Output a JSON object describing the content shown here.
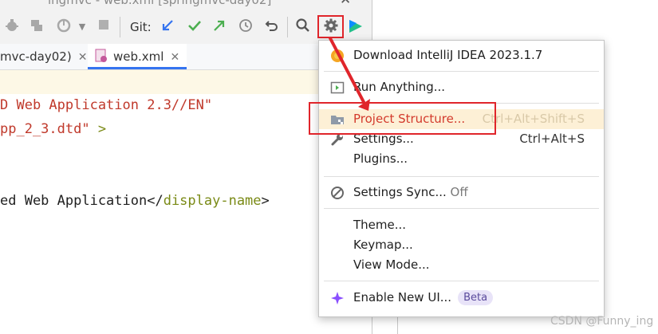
{
  "window": {
    "title": "ingmvc - web.xml [springmvc-day02]",
    "close_glyph": "✕"
  },
  "toolbar": {
    "git_label": "Git:",
    "icons": [
      "debug-icon",
      "coverage-icon",
      "profile-icon",
      "dropdown-icon",
      "stop-icon",
      "git-update-icon",
      "git-commit-icon",
      "git-push-icon",
      "history-icon",
      "rollback-icon",
      "search-icon",
      "gear-icon",
      "jetbrains-logo-icon"
    ]
  },
  "tabs": [
    {
      "label": "mvc-day02)",
      "close": "✕"
    },
    {
      "label": "web.xml",
      "close": "✕"
    }
  ],
  "editor": {
    "lines": [
      {
        "text": "D Web Application 2.3//EN\""
      },
      {
        "text": "pp_2_3.dtd\"",
        "suffix": " >"
      },
      {
        "text": ""
      },
      {
        "text": "ed Web Application</",
        "tag": "display-name",
        "suffix": ">"
      }
    ]
  },
  "menu": {
    "items": [
      {
        "label": "Download IntelliJ IDEA 2023.1.7",
        "icon": "update-icon"
      },
      {
        "label": "Run Anything...",
        "icon": "run-anything-icon"
      },
      {
        "label": "Project Structure...",
        "shortcut": "Ctrl+Alt+Shift+S",
        "icon": "project-structure-icon",
        "highlighted": true
      },
      {
        "label": "Settings...",
        "shortcut": "Ctrl+Alt+S",
        "icon": "wrench-icon"
      },
      {
        "label": "Plugins..."
      },
      {
        "label": "Settings Sync...",
        "status": "Off",
        "icon": "sync-off-icon"
      },
      {
        "label": "Theme..."
      },
      {
        "label": "Keymap..."
      },
      {
        "label": "View Mode..."
      },
      {
        "label": "Enable New UI...",
        "badge": "Beta",
        "icon": "sparkle-icon"
      }
    ]
  },
  "watermark": "CSDN @Funny_ing",
  "colors": {
    "annotation_red": "#e0252b",
    "highlight_bg": "#fdf0d6",
    "accent_blue": "#3574f0"
  }
}
